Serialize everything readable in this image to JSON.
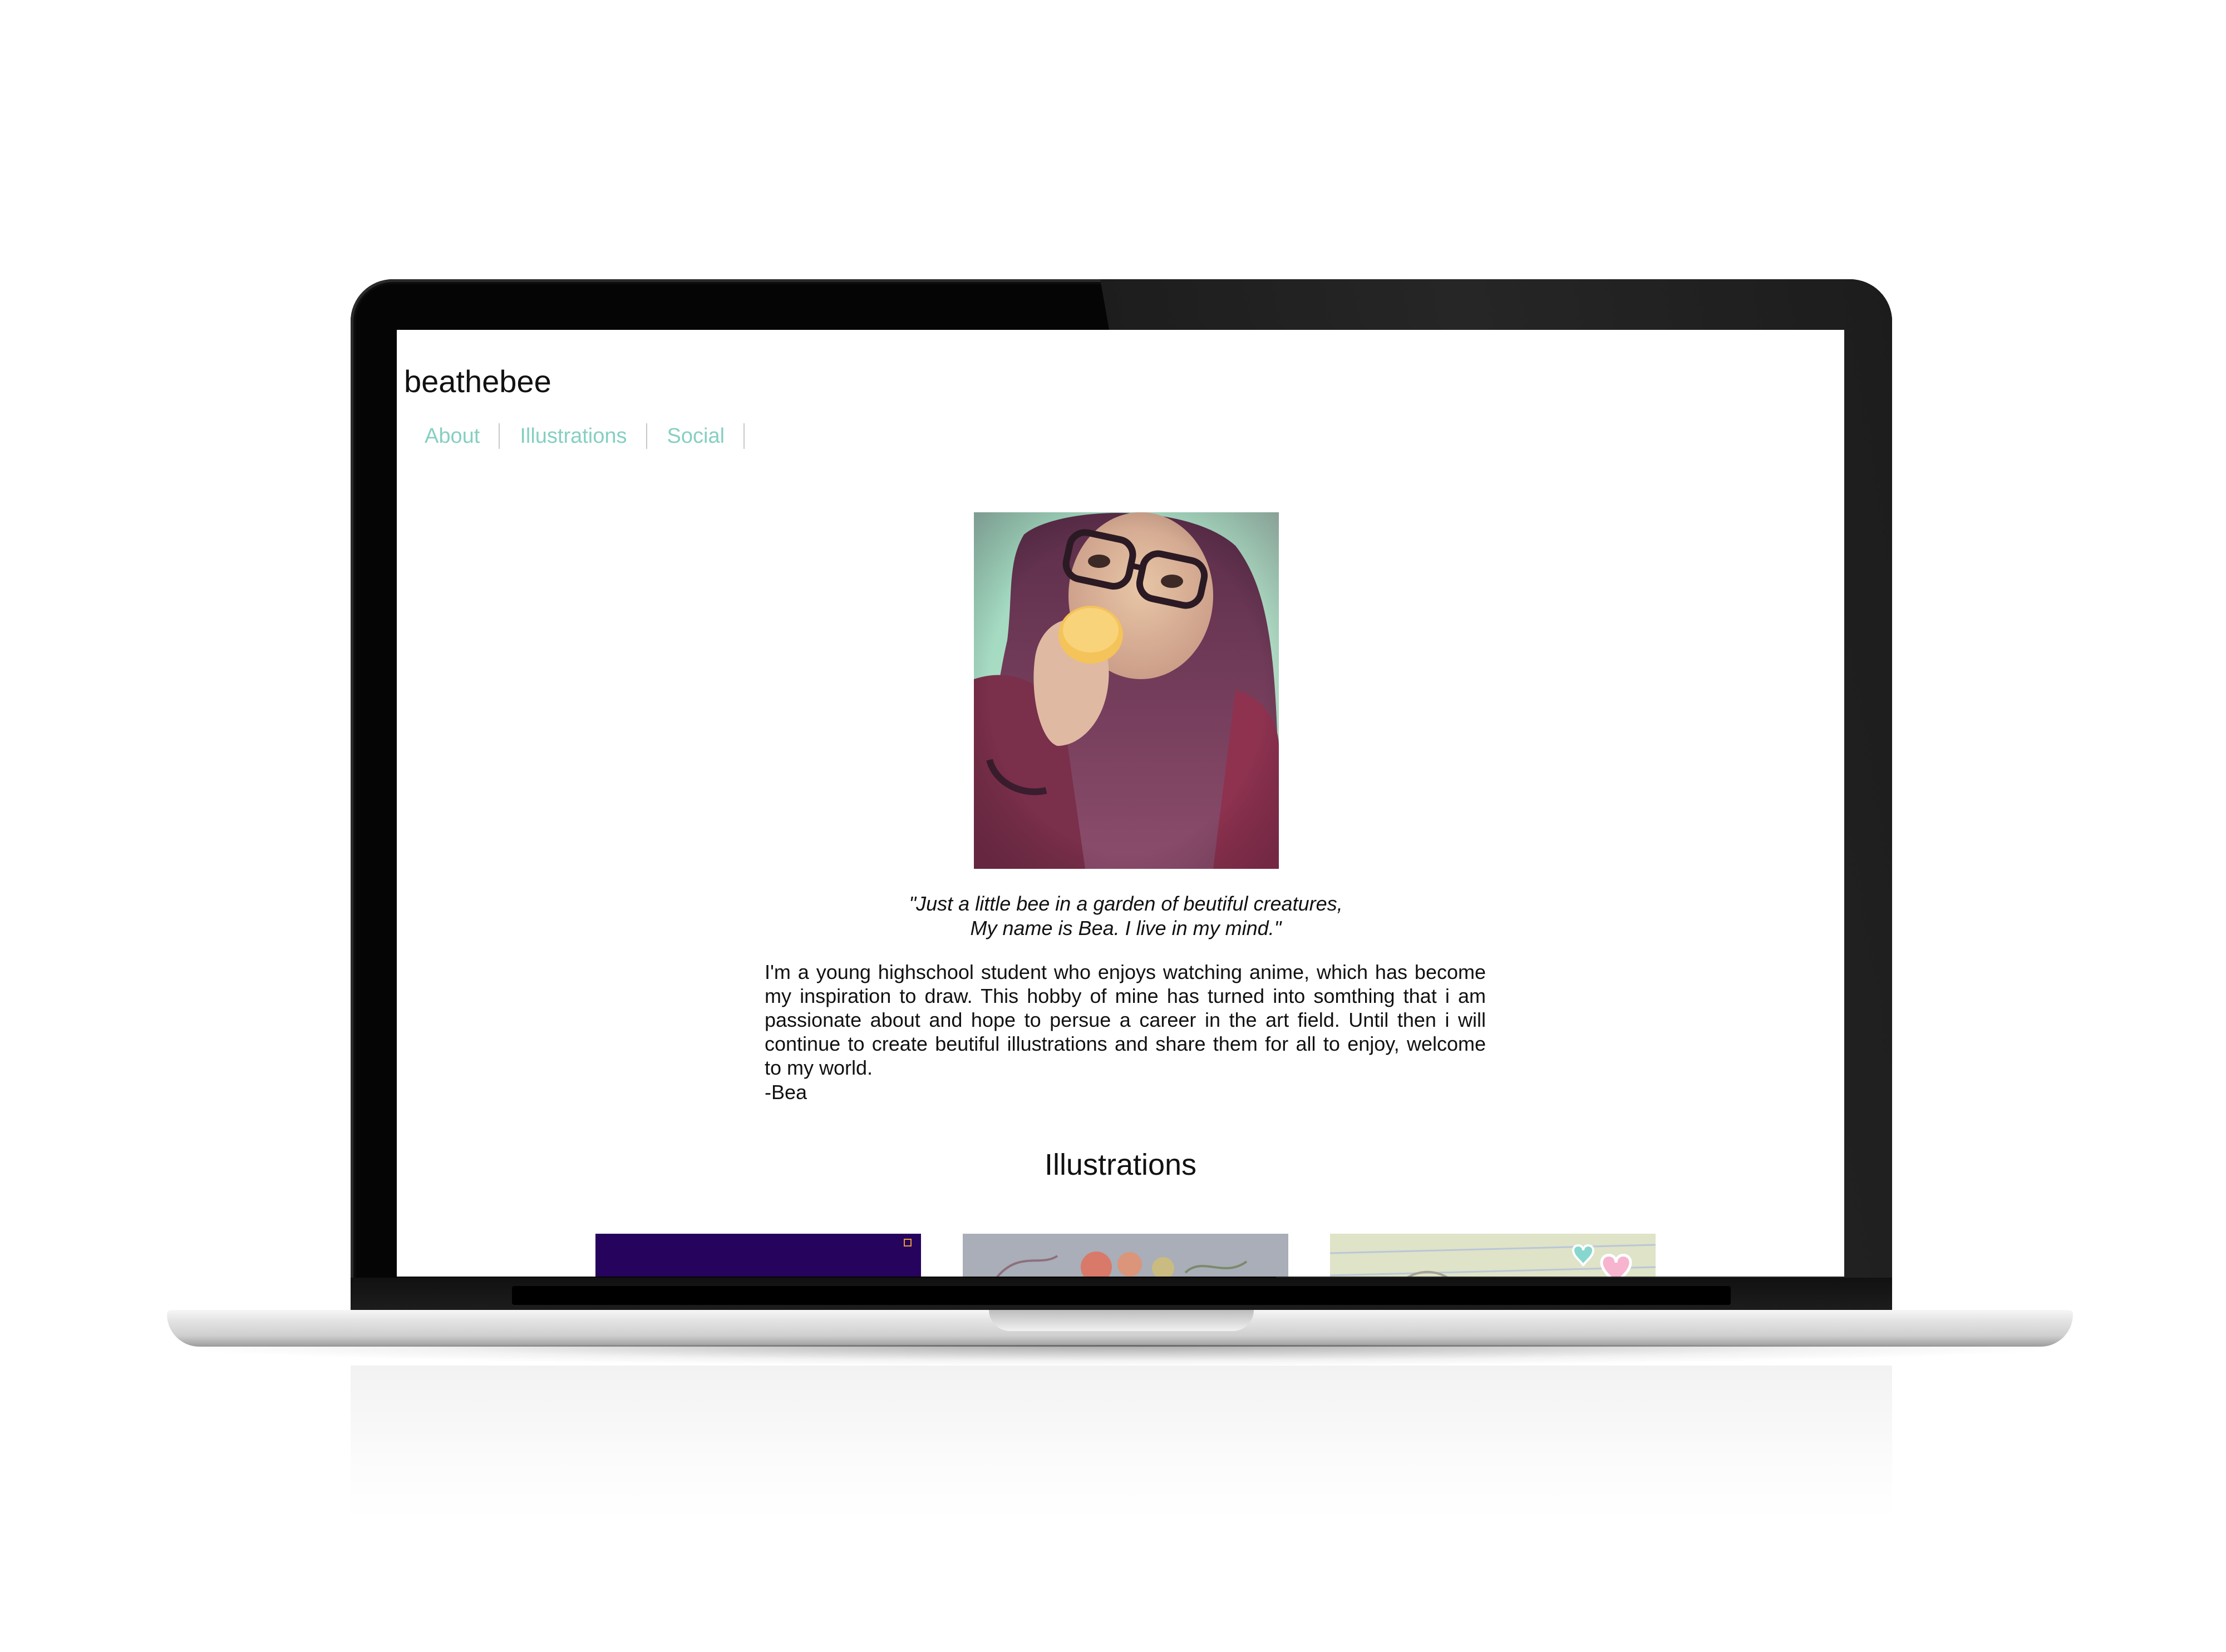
{
  "site": {
    "title": "beathebee"
  },
  "nav": {
    "items": [
      {
        "label": "About"
      },
      {
        "label": "Illustrations"
      },
      {
        "label": "Social"
      }
    ],
    "link_color": "#86cfc2"
  },
  "about": {
    "quote_line1": "\"Just a little bee in a garden of beutiful creatures,",
    "quote_line2": "My name is Bea. I live in my mind.\"",
    "bio": "I'm a young highschool student who enjoys watching anime, which has become my inspiration to draw. This hobby of mine has turned into somthing that i am passionate about and hope to persue a career in the art field. Until then i will continue to create beutiful illustrations and share them for all to enjoy, welcome to my world.",
    "signature": "-Bea"
  },
  "illustrations": {
    "heading": "Illustrations",
    "thumbnails": [
      {
        "name": "illustration-1",
        "color": "#26045e"
      },
      {
        "name": "illustration-2",
        "color": "#a7acb6"
      },
      {
        "name": "illustration-3",
        "color": "#dfe3c7"
      }
    ]
  }
}
